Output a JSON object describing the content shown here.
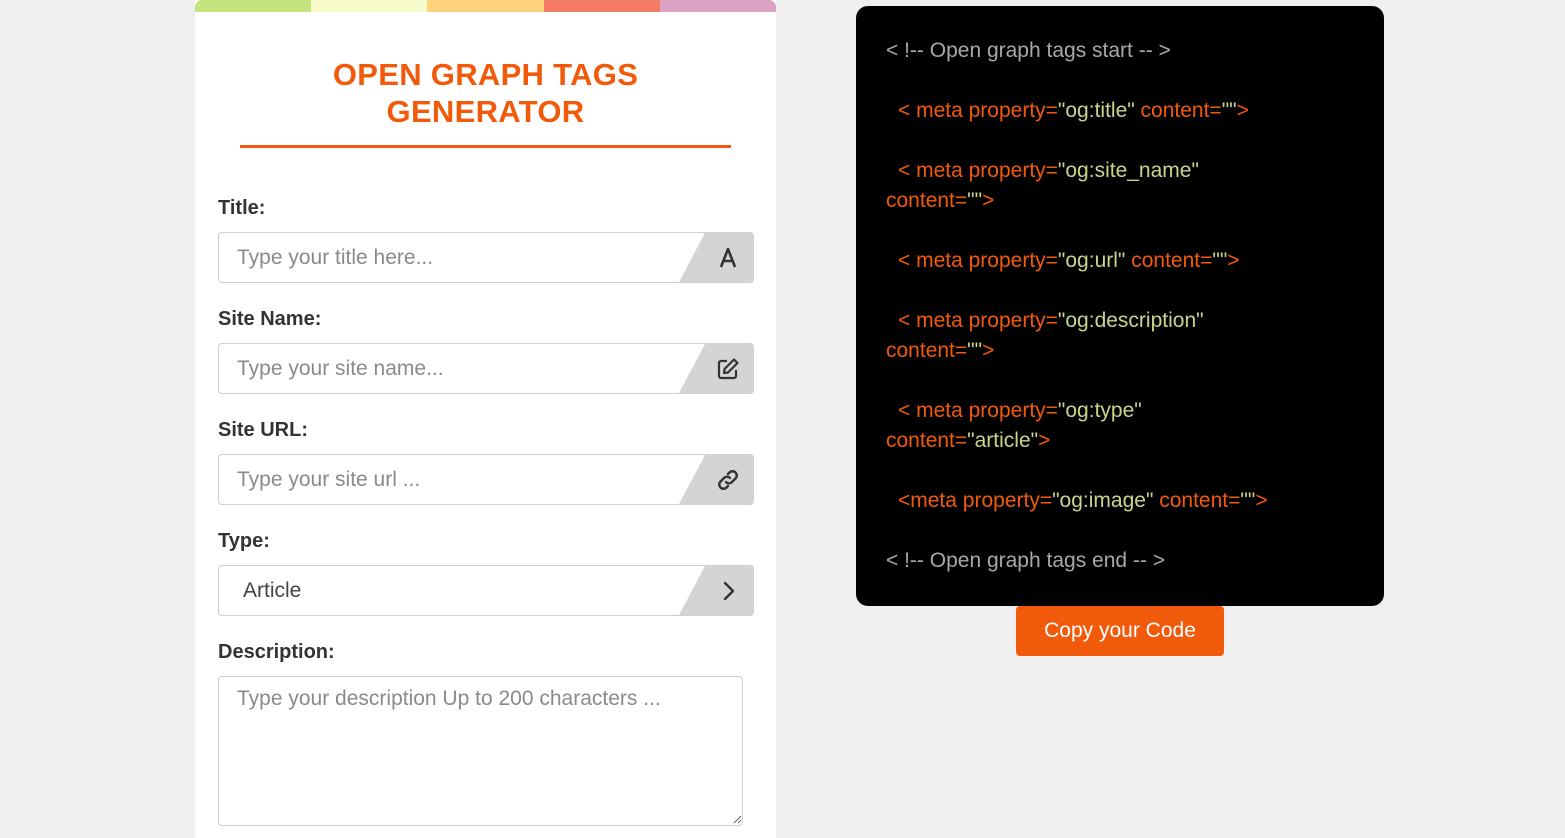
{
  "colors": {
    "accent": "#f15a0a",
    "stripe": [
      "#c5e37e",
      "#f7fbca",
      "#fdd27a",
      "#f37b68",
      "#dca2c3"
    ],
    "code_bg": "#000000",
    "code_value": "#c9d58c"
  },
  "form": {
    "title": "OPEN GRAPH TAGS GENERATOR",
    "fields": {
      "title": {
        "label": "Title:",
        "placeholder": "Type your title here...",
        "icon": "font-icon"
      },
      "site_name": {
        "label": "Site Name:",
        "placeholder": "Type your site name...",
        "icon": "edit-icon"
      },
      "site_url": {
        "label": "Site URL:",
        "placeholder": "Type your site url ...",
        "icon": "link-icon"
      },
      "type": {
        "label": "Type:",
        "value": "Article",
        "icon": "chevron-right-icon"
      },
      "description": {
        "label": "Description:",
        "placeholder": "Type your description Up to 200 characters ..."
      }
    }
  },
  "code": {
    "start_comment": "< !-- Open graph tags start -- >",
    "end_comment": "< !-- Open graph tags end -- >",
    "lines": {
      "title": {
        "pre": "< meta property=",
        "prop": "\"og:title\"",
        "mid": " content=",
        "val": "\"\"",
        "post": ">"
      },
      "site_name": {
        "pre": "< meta property=",
        "prop": "\"og:site_name\"",
        "mid": " content=",
        "val": "\"\"",
        "post": ">"
      },
      "url": {
        "pre": "< meta property=",
        "prop": "\"og:url\"",
        "mid": " content=",
        "val": "\"\"",
        "post": ">"
      },
      "description": {
        "pre": "< meta property=",
        "prop": "\"og:description\"",
        "mid": " content=",
        "val": "\"\"",
        "post": ">"
      },
      "type": {
        "pre": "< meta property=",
        "prop": "\"og:type\"",
        "mid": " content=",
        "val": "\"article\"",
        "post": ">"
      },
      "image": {
        "pre": "<meta property=",
        "prop": "\"og:image\"",
        "mid": " content=",
        "val": "\"\"",
        "post": ">"
      }
    },
    "copy_label": "Copy your Code"
  }
}
